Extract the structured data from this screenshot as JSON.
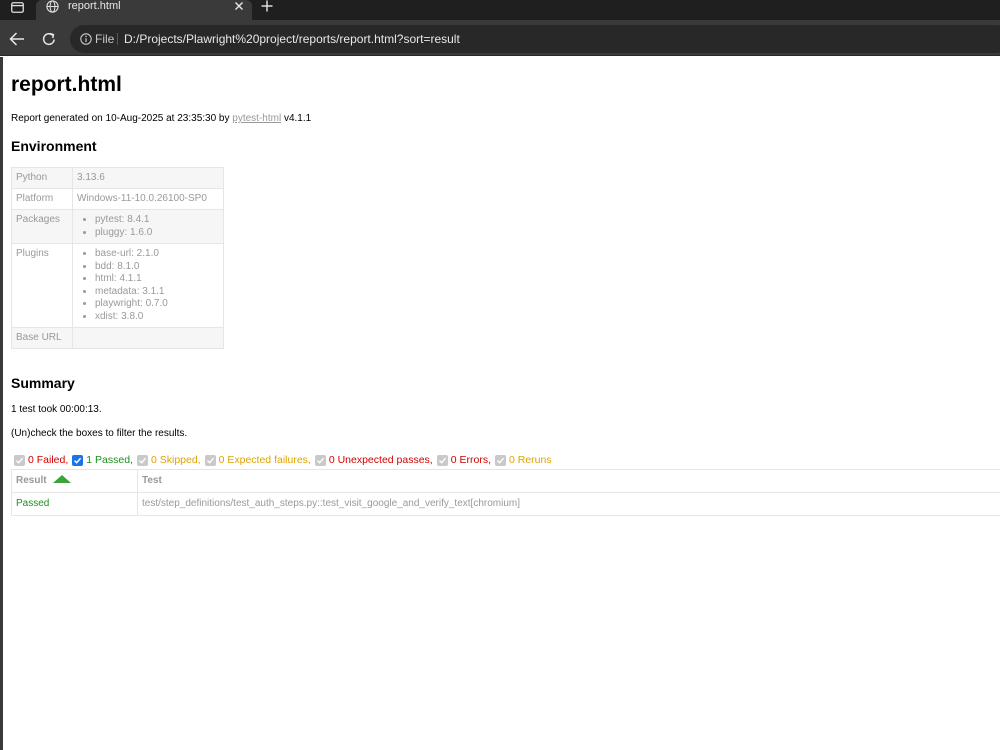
{
  "browser": {
    "tab_title": "report.html",
    "omnibox_label": "File",
    "url": "D:/Projects/Plawright%20project/reports/report.html?sort=result"
  },
  "report": {
    "title": "report.html",
    "generated_prefix": "Report generated on 10-Aug-2025 at 23:35:30 by ",
    "generated_link": "pytest-html",
    "generated_suffix": " v4.1.1"
  },
  "environment": {
    "heading": "Environment",
    "python_key": "Python",
    "python_value": "3.13.6",
    "platform_key": "Platform",
    "platform_value": "Windows-11-10.0.26100-SP0",
    "packages_key": "Packages",
    "packages": [
      "pytest: 8.4.1",
      "pluggy: 1.6.0"
    ],
    "plugins_key": "Plugins",
    "plugins": [
      "base-url: 2.1.0",
      "bdd: 8.1.0",
      "html: 4.1.1",
      "metadata: 3.1.1",
      "playwright: 0.7.0",
      "xdist: 3.8.0"
    ],
    "base_url_key": "Base URL",
    "base_url_value": ""
  },
  "summary": {
    "heading": "Summary",
    "duration": "1 test took 00:00:13.",
    "instructions": "(Un)check the boxes to filter the results.",
    "filters": {
      "failed": "0 Failed,",
      "passed": "1 Passed,",
      "skipped": "0 Skipped,",
      "xfailed": "0 Expected failures,",
      "xpassed": "0 Unexpected passes,",
      "errors": "0 Errors,",
      "reruns": "0 Reruns"
    }
  },
  "results": {
    "col_result": "Result",
    "col_test": "Test",
    "rows": [
      {
        "result": "Passed",
        "test": "test/step_definitions/test_auth_steps.py::test_visit_google_and_verify_text[chromium]"
      }
    ]
  },
  "colors": {
    "chrome_dark": "#1f1f1f",
    "chrome_toolbar": "#3a3a3a",
    "passed": "#1e8f1e",
    "failed": "#d20000",
    "skipped": "#e0a400",
    "checkbox_checked": "#1a73e8"
  },
  "icons": {
    "tab_strip": "tab-strip-icon",
    "tab_favicon": "globe-icon",
    "tab_close": "close-icon",
    "new_tab": "plus-icon",
    "back": "back-arrow-icon",
    "reload": "reload-icon",
    "site_info": "info-icon",
    "sort": "sort-up-icon"
  }
}
